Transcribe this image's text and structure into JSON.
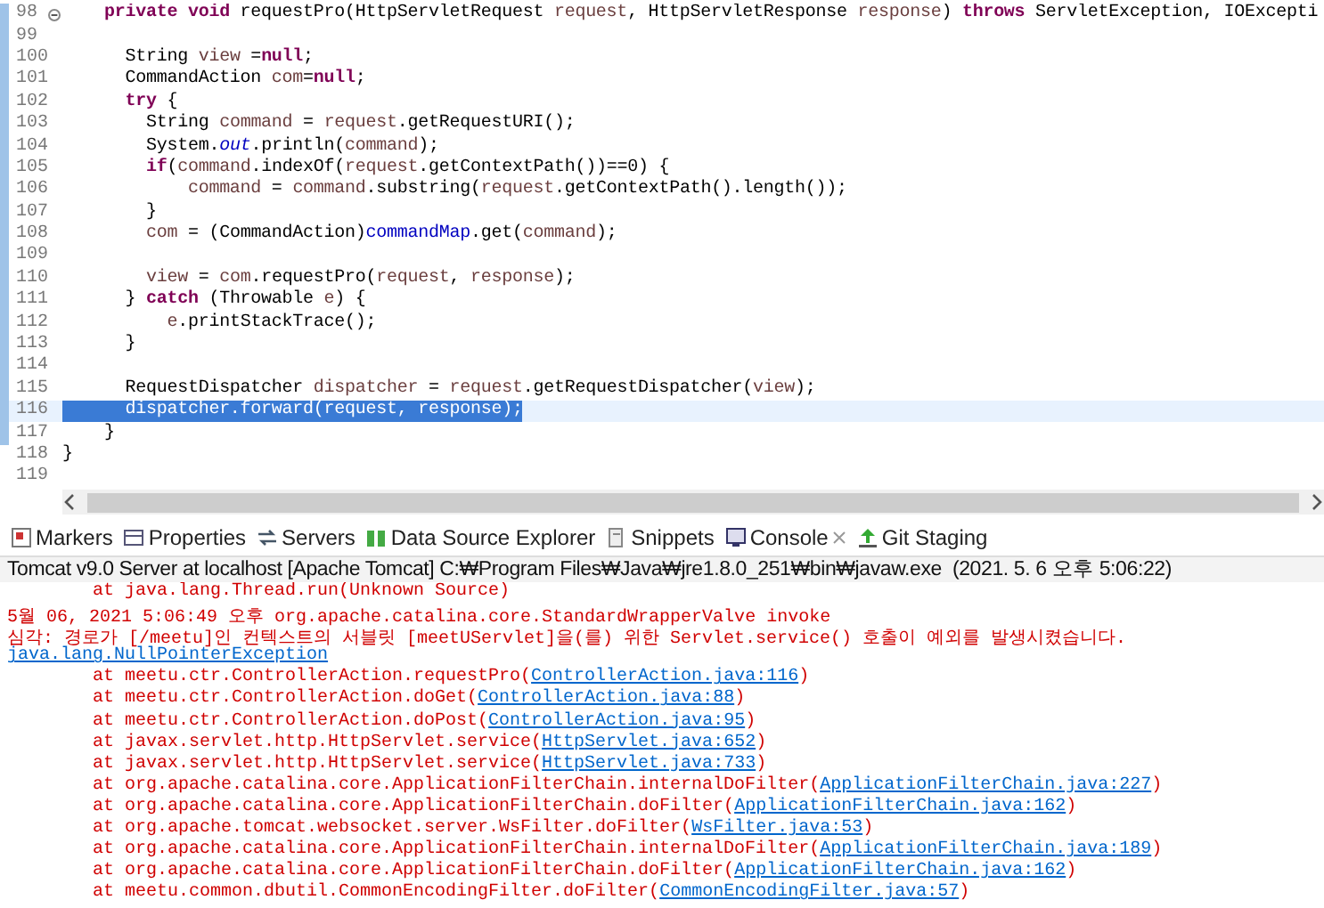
{
  "editor": {
    "lines": [
      {
        "number": "98",
        "foldable": true,
        "selected": false,
        "tokens": [
          {
            "text": "    private void",
            "kind": "keyword"
          },
          {
            "text": " requestPro(HttpServletRequest ",
            "kind": "plain"
          },
          {
            "text": "request",
            "kind": "variable"
          },
          {
            "text": ", HttpServletResponse ",
            "kind": "plain"
          },
          {
            "text": "response",
            "kind": "variable"
          },
          {
            "text": ") ",
            "kind": "plain"
          },
          {
            "text": "throws",
            "kind": "keyword"
          },
          {
            "text": " ServletException, IOExcepti",
            "kind": "plain"
          }
        ]
      },
      {
        "number": "99",
        "foldable": false,
        "selected": false
      },
      {
        "number": "100",
        "foldable": false,
        "selected": false,
        "tokens": [
          {
            "text": "      String ",
            "kind": "plain"
          },
          {
            "text": "view",
            "kind": "variable"
          },
          {
            "text": " =",
            "kind": "plain"
          },
          {
            "text": "null",
            "kind": "keyword"
          },
          {
            "text": ";",
            "kind": "plain"
          }
        ]
      },
      {
        "number": "101",
        "foldable": false,
        "selected": false,
        "tokens": [
          {
            "text": "      CommandAction ",
            "kind": "plain"
          },
          {
            "text": "com",
            "kind": "variable"
          },
          {
            "text": "=",
            "kind": "plain"
          },
          {
            "text": "null",
            "kind": "keyword"
          },
          {
            "text": ";",
            "kind": "plain"
          }
        ]
      },
      {
        "number": "102",
        "foldable": false,
        "selected": false,
        "tokens": [
          {
            "text": "      try",
            "kind": "keyword"
          },
          {
            "text": " {",
            "kind": "plain"
          }
        ]
      },
      {
        "number": "103",
        "foldable": false,
        "selected": false,
        "tokens": [
          {
            "text": "        String ",
            "kind": "plain"
          },
          {
            "text": "command",
            "kind": "variable"
          },
          {
            "text": " = ",
            "kind": "plain"
          },
          {
            "text": "request",
            "kind": "variable"
          },
          {
            "text": ".getRequestURI();",
            "kind": "plain"
          }
        ]
      },
      {
        "number": "104",
        "foldable": false,
        "selected": false,
        "tokens": [
          {
            "text": "        System.",
            "kind": "plain"
          },
          {
            "text": "out",
            "kind": "static"
          },
          {
            "text": ".println(",
            "kind": "plain"
          },
          {
            "text": "command",
            "kind": "variable"
          },
          {
            "text": ");",
            "kind": "plain"
          }
        ]
      },
      {
        "number": "105",
        "foldable": false,
        "selected": false,
        "tokens": [
          {
            "text": "        if",
            "kind": "keyword"
          },
          {
            "text": "(",
            "kind": "plain"
          },
          {
            "text": "command",
            "kind": "variable"
          },
          {
            "text": ".indexOf(",
            "kind": "plain"
          },
          {
            "text": "request",
            "kind": "variable"
          },
          {
            "text": ".getContextPath())==0) {",
            "kind": "plain"
          }
        ]
      },
      {
        "number": "106",
        "foldable": false,
        "selected": false,
        "tokens": [
          {
            "text": "            command",
            "kind": "variable"
          },
          {
            "text": " = ",
            "kind": "plain"
          },
          {
            "text": "command",
            "kind": "variable"
          },
          {
            "text": ".substring(",
            "kind": "plain"
          },
          {
            "text": "request",
            "kind": "variable"
          },
          {
            "text": ".getContextPath().length());",
            "kind": "plain"
          }
        ]
      },
      {
        "number": "107",
        "foldable": false,
        "selected": false,
        "tokens": [
          {
            "text": "        }",
            "kind": "plain"
          }
        ]
      },
      {
        "number": "108",
        "foldable": false,
        "selected": false,
        "tokens": [
          {
            "text": "        com",
            "kind": "variable"
          },
          {
            "text": " = (CommandAction)",
            "kind": "plain"
          },
          {
            "text": "commandMap",
            "kind": "field"
          },
          {
            "text": ".get(",
            "kind": "plain"
          },
          {
            "text": "command",
            "kind": "variable"
          },
          {
            "text": ");",
            "kind": "plain"
          }
        ]
      },
      {
        "number": "109",
        "foldable": false,
        "selected": false
      },
      {
        "number": "110",
        "foldable": false,
        "selected": false,
        "tokens": [
          {
            "text": "        view",
            "kind": "variable"
          },
          {
            "text": " = ",
            "kind": "plain"
          },
          {
            "text": "com",
            "kind": "variable"
          },
          {
            "text": ".requestPro(",
            "kind": "plain"
          },
          {
            "text": "request",
            "kind": "variable"
          },
          {
            "text": ", ",
            "kind": "plain"
          },
          {
            "text": "response",
            "kind": "variable"
          },
          {
            "text": ");",
            "kind": "plain"
          }
        ]
      },
      {
        "number": "111",
        "foldable": false,
        "selected": false,
        "tokens": [
          {
            "text": "      } ",
            "kind": "plain"
          },
          {
            "text": "catch",
            "kind": "keyword"
          },
          {
            "text": " (Throwable ",
            "kind": "plain"
          },
          {
            "text": "e",
            "kind": "variable"
          },
          {
            "text": ") {",
            "kind": "plain"
          }
        ]
      },
      {
        "number": "112",
        "foldable": false,
        "selected": false,
        "tokens": [
          {
            "text": "          e",
            "kind": "variable"
          },
          {
            "text": ".printStackTrace();",
            "kind": "plain"
          }
        ]
      },
      {
        "number": "113",
        "foldable": false,
        "selected": false,
        "tokens": [
          {
            "text": "      }",
            "kind": "plain"
          }
        ]
      },
      {
        "number": "114",
        "foldable": false,
        "selected": false
      },
      {
        "number": "115",
        "foldable": false,
        "selected": false,
        "tokens": [
          {
            "text": "      RequestDispatcher ",
            "kind": "plain"
          },
          {
            "text": "dispatcher",
            "kind": "variable"
          },
          {
            "text": " = ",
            "kind": "plain"
          },
          {
            "text": "request",
            "kind": "variable"
          },
          {
            "text": ".getRequestDispatcher(",
            "kind": "plain"
          },
          {
            "text": "view",
            "kind": "variable"
          },
          {
            "text": ");",
            "kind": "plain"
          }
        ]
      },
      {
        "number": "116",
        "foldable": false,
        "selected": true,
        "tokens": [
          {
            "text": "      dispatcher.forward(request, response);",
            "kind": "plain"
          }
        ]
      },
      {
        "number": "117",
        "foldable": false,
        "selected": false,
        "tokens": [
          {
            "text": "    }",
            "kind": "plain"
          }
        ]
      },
      {
        "number": "118",
        "foldable": false,
        "selected": false,
        "tokens": [
          {
            "text": "}",
            "kind": "plain"
          }
        ]
      },
      {
        "number": "119",
        "foldable": false,
        "selected": false
      }
    ]
  },
  "tabs": [
    {
      "label": "Markers",
      "selected": false
    },
    {
      "label": "Properties",
      "selected": false
    },
    {
      "label": "Servers",
      "selected": false
    },
    {
      "label": "Data Source Explorer",
      "selected": false
    },
    {
      "label": "Snippets",
      "selected": false
    },
    {
      "label": "Console",
      "selected": true
    },
    {
      "label": "Git Staging",
      "selected": false
    }
  ],
  "console": {
    "title": "Tomcat v9.0 Server at localhost [Apache Tomcat] C:₩Program Files₩Java₩jre1.8.0_251₩bin₩javaw.exe  (2021. 5. 6 오후 5:06:22)",
    "lines": [
      {
        "kind": "frame",
        "text": "at java.lang.Thread.run(Unknown Source)"
      },
      {
        "kind": "error",
        "text": "5월 06, 2021 5:06:49 오후 org.apache.catalina.core.StandardWrapperValve invoke"
      },
      {
        "kind": "error",
        "text": "심각: 경로가 [/meetu]인 컨텍스트의 서블릿 [meetUServlet]을(를) 위한 Servlet.service() 호출이 예외를 발생시켰습니다."
      },
      {
        "kind": "link",
        "text": "java.lang.NullPointerException"
      },
      {
        "kind": "frame",
        "text": "at meetu.ctr.ControllerAction.requestPro(",
        "link": "ControllerAction.java:116",
        "suffix": ")"
      },
      {
        "kind": "frame",
        "text": "at meetu.ctr.ControllerAction.doGet(",
        "link": "ControllerAction.java:88",
        "suffix": ")"
      },
      {
        "kind": "frame",
        "text": "at meetu.ctr.ControllerAction.doPost(",
        "link": "ControllerAction.java:95",
        "suffix": ")"
      },
      {
        "kind": "frame",
        "text": "at javax.servlet.http.HttpServlet.service(",
        "link": "HttpServlet.java:652",
        "suffix": ")"
      },
      {
        "kind": "frame",
        "text": "at javax.servlet.http.HttpServlet.service(",
        "link": "HttpServlet.java:733",
        "suffix": ")"
      },
      {
        "kind": "frame",
        "text": "at org.apache.catalina.core.ApplicationFilterChain.internalDoFilter(",
        "link": "ApplicationFilterChain.java:227",
        "suffix": ")"
      },
      {
        "kind": "frame",
        "text": "at org.apache.catalina.core.ApplicationFilterChain.doFilter(",
        "link": "ApplicationFilterChain.java:162",
        "suffix": ")"
      },
      {
        "kind": "frame",
        "text": "at org.apache.tomcat.websocket.server.WsFilter.doFilter(",
        "link": "WsFilter.java:53",
        "suffix": ")"
      },
      {
        "kind": "frame",
        "text": "at org.apache.catalina.core.ApplicationFilterChain.internalDoFilter(",
        "link": "ApplicationFilterChain.java:189",
        "suffix": ")"
      },
      {
        "kind": "frame",
        "text": "at org.apache.catalina.core.ApplicationFilterChain.doFilter(",
        "link": "ApplicationFilterChain.java:162",
        "suffix": ")"
      },
      {
        "kind": "frame",
        "text": "at meetu.common.dbutil.CommonEncodingFilter.doFilter(",
        "link": "CommonEncodingFilter.java:57",
        "suffix": ")"
      }
    ]
  }
}
